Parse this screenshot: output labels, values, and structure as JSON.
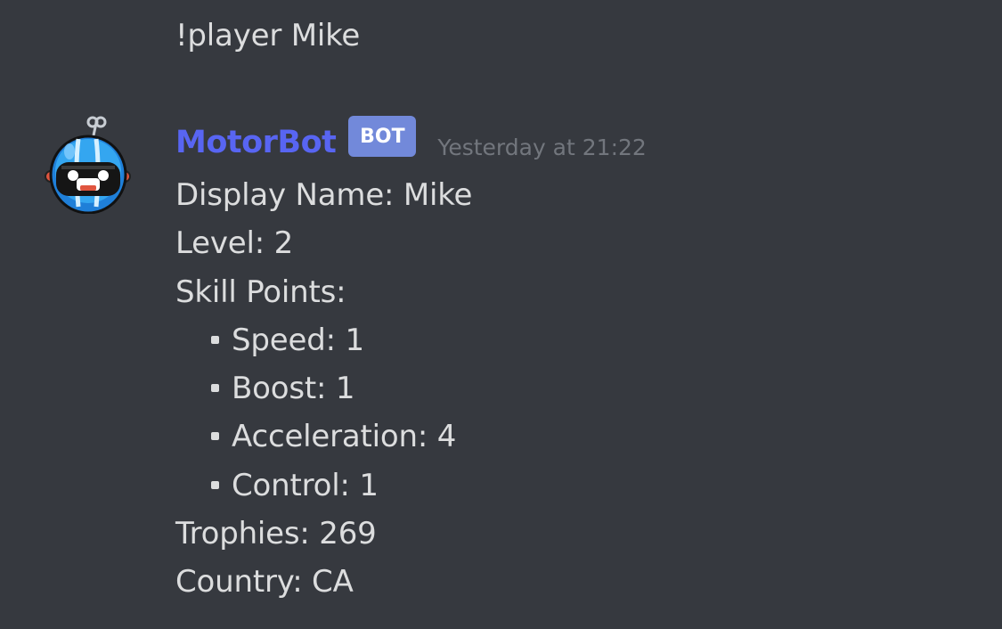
{
  "previous_message": {
    "text": "!player Mike"
  },
  "message": {
    "author": "MotorBot",
    "bot_tag": "BOT",
    "timestamp": "Yesterday at 21:22",
    "avatar_icon": "robot-avatar-icon",
    "lines": {
      "display_name": "Display Name: Mike",
      "level": "Level: 2",
      "skill_points": "Skill Points:",
      "trophies": "Trophies: 269",
      "country": "Country: CA"
    },
    "skills": [
      {
        "label": "Speed: 1"
      },
      {
        "label": "Boost: 1"
      },
      {
        "label": "Acceleration: 4"
      },
      {
        "label": "Control: 1"
      }
    ]
  },
  "colors": {
    "background": "#36393f",
    "text": "#dcddde",
    "username": "#5865f2",
    "bot_tag": "#7289da",
    "timestamp": "#72767d"
  }
}
